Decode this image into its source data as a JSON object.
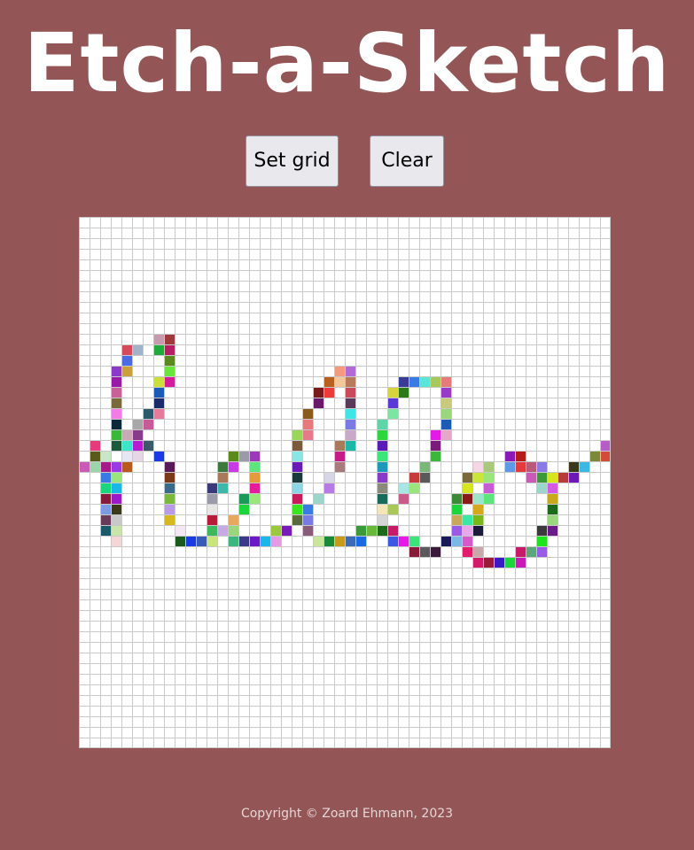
{
  "header": {
    "title": "Etch-a-Sketch"
  },
  "controls": {
    "set_grid_label": "Set grid",
    "clear_label": "Clear"
  },
  "grid": {
    "size": 50,
    "background": "#ffffff",
    "line_color": "#c8c8c8",
    "painted_cells": [
      {
        "r": 11,
        "c": 7,
        "color": "#c79aae"
      },
      {
        "r": 11,
        "c": 8,
        "color": "#a03a3a"
      },
      {
        "r": 12,
        "c": 4,
        "color": "#d64a5a"
      },
      {
        "r": 12,
        "c": 5,
        "color": "#9fb3c9"
      },
      {
        "r": 12,
        "c": 7,
        "color": "#1faa3c"
      },
      {
        "r": 12,
        "c": 8,
        "color": "#b81d64"
      },
      {
        "r": 13,
        "c": 4,
        "color": "#4a6ae6"
      },
      {
        "r": 13,
        "c": 8,
        "color": "#5a8a1e"
      },
      {
        "r": 14,
        "c": 3,
        "color": "#8a3ac9"
      },
      {
        "r": 14,
        "c": 4,
        "color": "#c9a03a"
      },
      {
        "r": 14,
        "c": 8,
        "color": "#6ae63a"
      },
      {
        "r": 14,
        "c": 24,
        "color": "#f59a7a"
      },
      {
        "r": 14,
        "c": 25,
        "color": "#b36ad6"
      },
      {
        "r": 15,
        "c": 3,
        "color": "#9a1aa8"
      },
      {
        "r": 15,
        "c": 7,
        "color": "#c9e03a"
      },
      {
        "r": 15,
        "c": 8,
        "color": "#d61a9a"
      },
      {
        "r": 15,
        "c": 23,
        "color": "#b8601e"
      },
      {
        "r": 15,
        "c": 24,
        "color": "#f0c89a"
      },
      {
        "r": 15,
        "c": 25,
        "color": "#b87a5a"
      },
      {
        "r": 15,
        "c": 30,
        "color": "#3a3a9a"
      },
      {
        "r": 15,
        "c": 31,
        "color": "#3a7ae6"
      },
      {
        "r": 15,
        "c": 32,
        "color": "#5ae6d6"
      },
      {
        "r": 15,
        "c": 33,
        "color": "#a8c95a"
      },
      {
        "r": 15,
        "c": 34,
        "color": "#e67a7a"
      },
      {
        "r": 16,
        "c": 3,
        "color": "#c9609a"
      },
      {
        "r": 16,
        "c": 7,
        "color": "#1a5ab8"
      },
      {
        "r": 16,
        "c": 22,
        "color": "#7a1a1a"
      },
      {
        "r": 16,
        "c": 23,
        "color": "#f03a3a"
      },
      {
        "r": 16,
        "c": 25,
        "color": "#c94a5a"
      },
      {
        "r": 16,
        "c": 29,
        "color": "#d6d63a"
      },
      {
        "r": 16,
        "c": 30,
        "color": "#2a7a1a"
      },
      {
        "r": 16,
        "c": 34,
        "color": "#9a3ac9"
      },
      {
        "r": 17,
        "c": 3,
        "color": "#7a6a3a"
      },
      {
        "r": 17,
        "c": 7,
        "color": "#1a2a6a"
      },
      {
        "r": 17,
        "c": 22,
        "color": "#6a1a6a"
      },
      {
        "r": 17,
        "c": 25,
        "color": "#5a3a5a"
      },
      {
        "r": 17,
        "c": 29,
        "color": "#5a3ad6"
      },
      {
        "r": 17,
        "c": 34,
        "color": "#c9c97a"
      },
      {
        "r": 18,
        "c": 3,
        "color": "#f57ae6"
      },
      {
        "r": 18,
        "c": 6,
        "color": "#2a5a6a"
      },
      {
        "r": 18,
        "c": 7,
        "color": "#e67a9a"
      },
      {
        "r": 18,
        "c": 21,
        "color": "#8a5a1a"
      },
      {
        "r": 18,
        "c": 25,
        "color": "#3ae6e6"
      },
      {
        "r": 18,
        "c": 29,
        "color": "#7ae6a0"
      },
      {
        "r": 18,
        "c": 34,
        "color": "#9ad67a"
      },
      {
        "r": 19,
        "c": 3,
        "color": "#0a2a3a"
      },
      {
        "r": 19,
        "c": 5,
        "color": "#a8a8a8"
      },
      {
        "r": 19,
        "c": 6,
        "color": "#c95a9a"
      },
      {
        "r": 19,
        "c": 21,
        "color": "#e67a7a"
      },
      {
        "r": 19,
        "c": 25,
        "color": "#7a7ae6"
      },
      {
        "r": 19,
        "c": 28,
        "color": "#5ad6a8"
      },
      {
        "r": 19,
        "c": 34,
        "color": "#1a5ab8"
      },
      {
        "r": 20,
        "c": 3,
        "color": "#3ab83a"
      },
      {
        "r": 20,
        "c": 4,
        "color": "#c9a8b8"
      },
      {
        "r": 20,
        "c": 5,
        "color": "#8a3a8a"
      },
      {
        "r": 20,
        "c": 20,
        "color": "#9ad65a"
      },
      {
        "r": 20,
        "c": 21,
        "color": "#e67a8a"
      },
      {
        "r": 20,
        "c": 25,
        "color": "#c9a8c9"
      },
      {
        "r": 20,
        "c": 28,
        "color": "#2ad63a"
      },
      {
        "r": 20,
        "c": 33,
        "color": "#e61ae6"
      },
      {
        "r": 20,
        "c": 34,
        "color": "#e6a8c9"
      },
      {
        "r": 21,
        "c": 1,
        "color": "#e63a7a"
      },
      {
        "r": 21,
        "c": 3,
        "color": "#1a5a3a"
      },
      {
        "r": 21,
        "c": 4,
        "color": "#3ae6c9"
      },
      {
        "r": 21,
        "c": 5,
        "color": "#b81ad6"
      },
      {
        "r": 21,
        "c": 6,
        "color": "#3a5a6a"
      },
      {
        "r": 21,
        "c": 20,
        "color": "#7a5a3a"
      },
      {
        "r": 21,
        "c": 24,
        "color": "#a87a5a"
      },
      {
        "r": 21,
        "c": 25,
        "color": "#1ab8a8"
      },
      {
        "r": 21,
        "c": 28,
        "color": "#5a1ab8"
      },
      {
        "r": 21,
        "c": 33,
        "color": "#7a1a7a"
      },
      {
        "r": 21,
        "c": 49,
        "color": "#b85ac9"
      },
      {
        "r": 22,
        "c": 1,
        "color": "#5a5a1a"
      },
      {
        "r": 22,
        "c": 2,
        "color": "#c9e6c9"
      },
      {
        "r": 22,
        "c": 4,
        "color": "#e6e6f5"
      },
      {
        "r": 22,
        "c": 5,
        "color": "#e6d6e6"
      },
      {
        "r": 22,
        "c": 7,
        "color": "#1a3ae6"
      },
      {
        "r": 22,
        "c": 14,
        "color": "#5a8a1a"
      },
      {
        "r": 22,
        "c": 15,
        "color": "#9a9aa8"
      },
      {
        "r": 22,
        "c": 16,
        "color": "#9a3ab8"
      },
      {
        "r": 22,
        "c": 20,
        "color": "#8ae6e6"
      },
      {
        "r": 22,
        "c": 24,
        "color": "#c91a8a"
      },
      {
        "r": 22,
        "c": 28,
        "color": "#3ae67a"
      },
      {
        "r": 22,
        "c": 33,
        "color": "#3ab83a"
      },
      {
        "r": 22,
        "c": 40,
        "color": "#8a1ab8"
      },
      {
        "r": 22,
        "c": 41,
        "color": "#b81a1a"
      },
      {
        "r": 22,
        "c": 48,
        "color": "#7a8a3a"
      },
      {
        "r": 22,
        "c": 49,
        "color": "#d64a3a"
      },
      {
        "r": 23,
        "c": 0,
        "color": "#c95ab8"
      },
      {
        "r": 23,
        "c": 1,
        "color": "#9ad6a8"
      },
      {
        "r": 23,
        "c": 2,
        "color": "#a81a8a"
      },
      {
        "r": 23,
        "c": 3,
        "color": "#9a3ae6"
      },
      {
        "r": 23,
        "c": 4,
        "color": "#b85a1a"
      },
      {
        "r": 23,
        "c": 8,
        "color": "#5a1a5a"
      },
      {
        "r": 23,
        "c": 13,
        "color": "#3a7a3a"
      },
      {
        "r": 23,
        "c": 14,
        "color": "#c93ae6"
      },
      {
        "r": 23,
        "c": 16,
        "color": "#5ae67a"
      },
      {
        "r": 23,
        "c": 20,
        "color": "#6a1ab8"
      },
      {
        "r": 23,
        "c": 24,
        "color": "#a87a7a"
      },
      {
        "r": 23,
        "c": 28,
        "color": "#1a9ab8"
      },
      {
        "r": 23,
        "c": 32,
        "color": "#7ab87a"
      },
      {
        "r": 23,
        "c": 37,
        "color": "#f5d6e6"
      },
      {
        "r": 23,
        "c": 38,
        "color": "#a8c97a"
      },
      {
        "r": 23,
        "c": 40,
        "color": "#5a9ae6"
      },
      {
        "r": 23,
        "c": 41,
        "color": "#e63a3a"
      },
      {
        "r": 23,
        "c": 42,
        "color": "#b85a7a"
      },
      {
        "r": 23,
        "c": 43,
        "color": "#8a7ae6"
      },
      {
        "r": 23,
        "c": 46,
        "color": "#3a3a1a"
      },
      {
        "r": 23,
        "c": 47,
        "color": "#3ab8e6"
      },
      {
        "r": 24,
        "c": 2,
        "color": "#3a7ae6"
      },
      {
        "r": 24,
        "c": 3,
        "color": "#9ae67a"
      },
      {
        "r": 24,
        "c": 8,
        "color": "#7a3a1a"
      },
      {
        "r": 24,
        "c": 13,
        "color": "#a87a5a"
      },
      {
        "r": 24,
        "c": 16,
        "color": "#e69a3a"
      },
      {
        "r": 24,
        "c": 20,
        "color": "#1a3a3a"
      },
      {
        "r": 24,
        "c": 23,
        "color": "#d6d6e6"
      },
      {
        "r": 24,
        "c": 28,
        "color": "#8a3ac9"
      },
      {
        "r": 24,
        "c": 31,
        "color": "#c93a3a"
      },
      {
        "r": 24,
        "c": 32,
        "color": "#5a5a5a"
      },
      {
        "r": 24,
        "c": 36,
        "color": "#7a6a3a"
      },
      {
        "r": 24,
        "c": 37,
        "color": "#c9e63a"
      },
      {
        "r": 24,
        "c": 38,
        "color": "#9ae67a"
      },
      {
        "r": 24,
        "c": 42,
        "color": "#c95ab8"
      },
      {
        "r": 24,
        "c": 43,
        "color": "#3a9a3a"
      },
      {
        "r": 24,
        "c": 44,
        "color": "#d6e61a"
      },
      {
        "r": 24,
        "c": 45,
        "color": "#b83a3a"
      },
      {
        "r": 24,
        "c": 46,
        "color": "#6a1ab8"
      },
      {
        "r": 25,
        "c": 2,
        "color": "#1ad67a"
      },
      {
        "r": 25,
        "c": 3,
        "color": "#1ab8e6"
      },
      {
        "r": 25,
        "c": 8,
        "color": "#3a6a8a"
      },
      {
        "r": 25,
        "c": 12,
        "color": "#3a3a7a"
      },
      {
        "r": 25,
        "c": 13,
        "color": "#3ab8a8"
      },
      {
        "r": 25,
        "c": 16,
        "color": "#e61a9a"
      },
      {
        "r": 25,
        "c": 20,
        "color": "#8ad6e6"
      },
      {
        "r": 25,
        "c": 23,
        "color": "#b87ae6"
      },
      {
        "r": 25,
        "c": 28,
        "color": "#8a8a7a"
      },
      {
        "r": 25,
        "c": 30,
        "color": "#a8e6e6"
      },
      {
        "r": 25,
        "c": 31,
        "color": "#9ae67a"
      },
      {
        "r": 25,
        "c": 36,
        "color": "#d6e61a"
      },
      {
        "r": 25,
        "c": 38,
        "color": "#c95ad6"
      },
      {
        "r": 25,
        "c": 43,
        "color": "#9ad6c9"
      },
      {
        "r": 25,
        "c": 44,
        "color": "#d65ae6"
      },
      {
        "r": 26,
        "c": 2,
        "color": "#8a1a3a"
      },
      {
        "r": 26,
        "c": 3,
        "color": "#9a1ac9"
      },
      {
        "r": 26,
        "c": 8,
        "color": "#7ab83a"
      },
      {
        "r": 26,
        "c": 12,
        "color": "#9a9aa8"
      },
      {
        "r": 26,
        "c": 15,
        "color": "#1a9a5a"
      },
      {
        "r": 26,
        "c": 16,
        "color": "#9ae67a"
      },
      {
        "r": 26,
        "c": 20,
        "color": "#c91a5a"
      },
      {
        "r": 26,
        "c": 22,
        "color": "#9ad6c9"
      },
      {
        "r": 26,
        "c": 28,
        "color": "#1a6a5a"
      },
      {
        "r": 26,
        "c": 30,
        "color": "#c95a8a"
      },
      {
        "r": 26,
        "c": 35,
        "color": "#3a8a3a"
      },
      {
        "r": 26,
        "c": 36,
        "color": "#8a1a1a"
      },
      {
        "r": 26,
        "c": 37,
        "color": "#9ae6c9"
      },
      {
        "r": 26,
        "c": 38,
        "color": "#5ae67a"
      },
      {
        "r": 26,
        "c": 44,
        "color": "#c9a81a"
      },
      {
        "r": 27,
        "c": 2,
        "color": "#7a9ae6"
      },
      {
        "r": 27,
        "c": 3,
        "color": "#3a3a1a"
      },
      {
        "r": 27,
        "c": 8,
        "color": "#b89ae6"
      },
      {
        "r": 27,
        "c": 12,
        "color": "#e6e6e6"
      },
      {
        "r": 27,
        "c": 15,
        "color": "#1ad63a"
      },
      {
        "r": 27,
        "c": 20,
        "color": "#3ae61a"
      },
      {
        "r": 27,
        "c": 21,
        "color": "#3a7ae6"
      },
      {
        "r": 27,
        "c": 28,
        "color": "#f5e6b8"
      },
      {
        "r": 27,
        "c": 29,
        "color": "#a8c95a"
      },
      {
        "r": 27,
        "c": 35,
        "color": "#1ad63a"
      },
      {
        "r": 27,
        "c": 37,
        "color": "#d6a81a"
      },
      {
        "r": 27,
        "c": 44,
        "color": "#1a6a1a"
      },
      {
        "r": 28,
        "c": 2,
        "color": "#6a3a5a"
      },
      {
        "r": 28,
        "c": 3,
        "color": "#c9c9c9"
      },
      {
        "r": 28,
        "c": 8,
        "color": "#d6b81a"
      },
      {
        "r": 28,
        "c": 12,
        "color": "#b81a3a"
      },
      {
        "r": 28,
        "c": 14,
        "color": "#e6a85a"
      },
      {
        "r": 28,
        "c": 20,
        "color": "#5a6a3a"
      },
      {
        "r": 28,
        "c": 21,
        "color": "#7a7ae6"
      },
      {
        "r": 28,
        "c": 28,
        "color": "#d6d6d6"
      },
      {
        "r": 28,
        "c": 35,
        "color": "#c9a85a"
      },
      {
        "r": 28,
        "c": 36,
        "color": "#3ae6a8"
      },
      {
        "r": 28,
        "c": 37,
        "color": "#7ab81a"
      },
      {
        "r": 28,
        "c": 44,
        "color": "#9ad67a"
      },
      {
        "r": 29,
        "c": 2,
        "color": "#1a5a6a"
      },
      {
        "r": 29,
        "c": 3,
        "color": "#c9e6a8"
      },
      {
        "r": 29,
        "c": 9,
        "color": "#f5e6f5"
      },
      {
        "r": 29,
        "c": 12,
        "color": "#3ab85a"
      },
      {
        "r": 29,
        "c": 13,
        "color": "#c9a8e6"
      },
      {
        "r": 29,
        "c": 14,
        "color": "#9ad67a"
      },
      {
        "r": 29,
        "c": 18,
        "color": "#9ac93a"
      },
      {
        "r": 29,
        "c": 19,
        "color": "#7a1ab8"
      },
      {
        "r": 29,
        "c": 21,
        "color": "#8a5a7a"
      },
      {
        "r": 29,
        "c": 26,
        "color": "#3a9a3a"
      },
      {
        "r": 29,
        "c": 27,
        "color": "#6ab83a"
      },
      {
        "r": 29,
        "c": 28,
        "color": "#1a6a1a"
      },
      {
        "r": 29,
        "c": 29,
        "color": "#c91a6a"
      },
      {
        "r": 29,
        "c": 35,
        "color": "#9a5ae6"
      },
      {
        "r": 29,
        "c": 36,
        "color": "#e6a8e6"
      },
      {
        "r": 29,
        "c": 37,
        "color": "#1a1a3a"
      },
      {
        "r": 29,
        "c": 43,
        "color": "#3a3a3a"
      },
      {
        "r": 29,
        "c": 44,
        "color": "#6a1a8a"
      },
      {
        "r": 30,
        "c": 3,
        "color": "#f5d6d6"
      },
      {
        "r": 30,
        "c": 9,
        "color": "#1a5a1a"
      },
      {
        "r": 30,
        "c": 10,
        "color": "#1a3ae6"
      },
      {
        "r": 30,
        "c": 11,
        "color": "#3a5ab8"
      },
      {
        "r": 30,
        "c": 12,
        "color": "#c9e67a"
      },
      {
        "r": 30,
        "c": 14,
        "color": "#3ab87a"
      },
      {
        "r": 30,
        "c": 15,
        "color": "#3a3a8a"
      },
      {
        "r": 30,
        "c": 16,
        "color": "#6a1ac9"
      },
      {
        "r": 30,
        "c": 17,
        "color": "#1ab8e6"
      },
      {
        "r": 30,
        "c": 18,
        "color": "#e69ae6"
      },
      {
        "r": 30,
        "c": 22,
        "color": "#c9e69a"
      },
      {
        "r": 30,
        "c": 23,
        "color": "#1a8a3a"
      },
      {
        "r": 30,
        "c": 24,
        "color": "#c99a1a"
      },
      {
        "r": 30,
        "c": 25,
        "color": "#3a6ab8"
      },
      {
        "r": 30,
        "c": 26,
        "color": "#1a6ae6"
      },
      {
        "r": 30,
        "c": 29,
        "color": "#3a5ae6"
      },
      {
        "r": 30,
        "c": 30,
        "color": "#e61ae6"
      },
      {
        "r": 30,
        "c": 31,
        "color": "#3ae67a"
      },
      {
        "r": 30,
        "c": 34,
        "color": "#1a1a5a"
      },
      {
        "r": 30,
        "c": 35,
        "color": "#7ab8e6"
      },
      {
        "r": 30,
        "c": 36,
        "color": "#d65ac9"
      },
      {
        "r": 30,
        "c": 43,
        "color": "#1ae61a"
      },
      {
        "r": 31,
        "c": 31,
        "color": "#8a1a3a"
      },
      {
        "r": 31,
        "c": 32,
        "color": "#5a5a5a"
      },
      {
        "r": 31,
        "c": 33,
        "color": "#3a1a3a"
      },
      {
        "r": 31,
        "c": 36,
        "color": "#e61a6a"
      },
      {
        "r": 31,
        "c": 37,
        "color": "#c9a8a8"
      },
      {
        "r": 31,
        "c": 41,
        "color": "#c91a6a"
      },
      {
        "r": 31,
        "c": 42,
        "color": "#5aa87a"
      },
      {
        "r": 31,
        "c": 43,
        "color": "#9a5ae6"
      },
      {
        "r": 32,
        "c": 37,
        "color": "#d61a6a"
      },
      {
        "r": 32,
        "c": 38,
        "color": "#9a1a3a"
      },
      {
        "r": 32,
        "c": 39,
        "color": "#3a1ac9"
      },
      {
        "r": 32,
        "c": 40,
        "color": "#1ad63a"
      },
      {
        "r": 32,
        "c": 41,
        "color": "#c91ab8"
      }
    ]
  },
  "footer": {
    "copyright": "Copyright © Zoard Ehmann, 2023"
  }
}
